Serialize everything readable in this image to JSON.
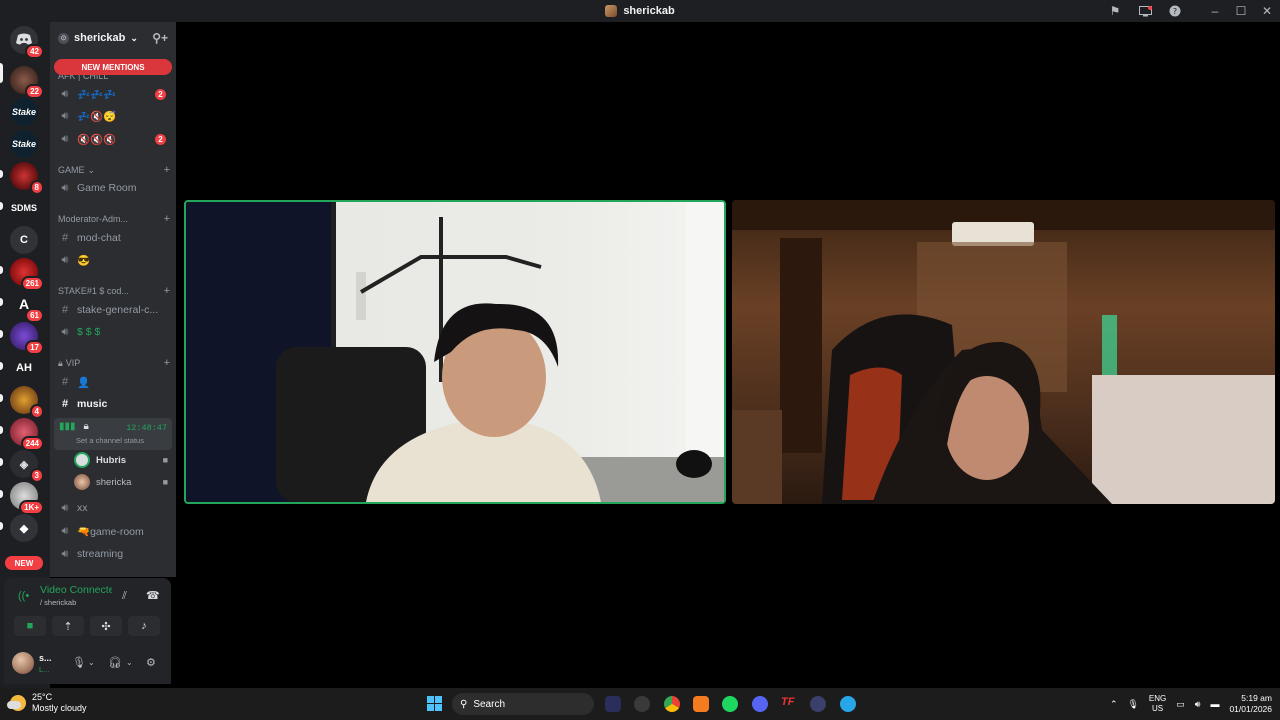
{
  "window": {
    "title": "sherickab",
    "icons": [
      "inbox-icon",
      "screen-icon",
      "help-icon"
    ],
    "controls": [
      "minimize",
      "maximize",
      "close"
    ]
  },
  "servers": [
    {
      "label": "",
      "badge": "42",
      "icon": "discord-icon"
    },
    {
      "label": "",
      "badge": "22"
    },
    {
      "label": "Stake",
      "badge": ""
    },
    {
      "label": "Stake",
      "badge": ""
    },
    {
      "label": "",
      "badge": "8"
    },
    {
      "label": "SDMS",
      "badge": ""
    },
    {
      "label": "C",
      "badge": ""
    },
    {
      "label": "",
      "badge": "261"
    },
    {
      "label": "A",
      "badge": "61"
    },
    {
      "label": "",
      "badge": "17"
    },
    {
      "label": "AH",
      "badge": ""
    },
    {
      "label": "",
      "badge": "4"
    },
    {
      "label": "",
      "badge": "244"
    },
    {
      "label": "",
      "badge": "3"
    },
    {
      "label": "",
      "badge": "1K+"
    },
    {
      "label": "",
      "badge": ""
    }
  ],
  "new_label": "NEW",
  "guild": {
    "name": "sherickab",
    "new_mentions": "NEW MENTIONS"
  },
  "channels": {
    "afk_cat": "AFK | CHILL",
    "afk_1": "💤💤💤",
    "afk_1_count": "2",
    "afk_2": "💤🔇😴",
    "afk_3": "🔇🔇🔇",
    "afk_3_count": "2",
    "game_cat": "GAME",
    "game_room": "Game Room",
    "mod_cat": "Moderator-Adm...",
    "mod_chat": "mod-chat",
    "mod_voice": "😎",
    "stake_cat": "STAKE#1 $ cod...",
    "stake_general": "stake-general-c...",
    "stake_voice": "$ $ $",
    "vip_cat": "VIP",
    "vip_1": "👤",
    "music": "music",
    "voice_active_timer": "12:48:47",
    "voice_status": "Set a channel status",
    "members": [
      {
        "name": "Hubris"
      },
      {
        "name": "shericka"
      }
    ],
    "xx": "xx",
    "game_room_voice": "🔫game-room",
    "streaming": "streaming"
  },
  "voice_panel": {
    "status": "Video Connected",
    "sub": "/ sherickab"
  },
  "user_panel": {
    "name": "s...",
    "sub": "L..."
  },
  "taskbar": {
    "temp": "25°C",
    "condition": "Mostly cloudy",
    "search": "Search",
    "lang1": "ENG",
    "lang2": "US",
    "time": "5:19 am",
    "date": "01/01/2026"
  }
}
